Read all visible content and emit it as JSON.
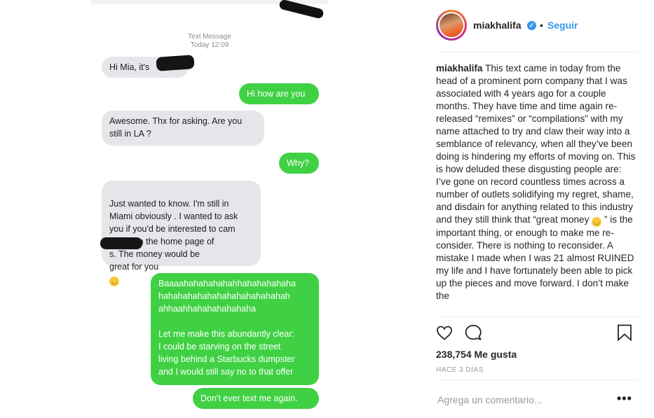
{
  "sms": {
    "meta_label": "Text Message",
    "meta_time": "Today 12:09",
    "messages": [
      {
        "direction": "incoming",
        "text": "Hi Mia, it's"
      },
      {
        "direction": "outgoing",
        "text": "Hi how are you"
      },
      {
        "direction": "incoming",
        "text": "Awesome. Thx for asking. Are you\nstill in LA ?"
      },
      {
        "direction": "outgoing",
        "text": "Why?"
      },
      {
        "direction": "incoming",
        "text": "Just wanted to know. I'm still in\nMiami obviously . I wanted to ask\nyou if you'd be interested to cam\nfor us on the home page of\n             s. The money would be\ngreat for you"
      },
      {
        "direction": "outgoing",
        "text": "Baaaahahahahahahhahahahahaha\nhahahahahahahahahahahahahah\nahhaahhahahahahahaha\n\nLet me make this abundantly clear:\nI could be starving on the street\nliving behind a Starbucks dumpster\nand I would still say no to that offer"
      },
      {
        "direction": "outgoing",
        "text": "Don't ever text me again."
      }
    ],
    "bubble_in_color": "#e5e5ea",
    "bubble_out_color": "#3fd143"
  },
  "post": {
    "username": "miakhalifa",
    "verified": true,
    "separator": "•",
    "follow_label": "Seguir",
    "follow_color": "#3897f0",
    "caption_username": "miakhalifa",
    "caption_before_emoji": "This text came in today from the head of a prominent porn company that I was associated with 4 years ago for a couple months. They have time and time again re-released “remixes” or “compilations” with my name attached to try and claw their way into a semblance of relevancy, when all they’ve been doing is hindering my efforts of moving on. This is how deluded these disgusting people are: I’ve gone on record countless times across a number of outlets solidifying my regret, shame, and disdain for anything related to this industry and they still think that “great money",
    "caption_after_emoji": "” is the important thing, or enough to make me re-consider. There is nothing to reconsider. A mistake I made when I was 21 almost RUINED my life and I have fortunately been able to pick up the pieces and move forward. I don’t make the",
    "likes": "238,754 Me gusta",
    "time_ago": "HACE 3 DÍAS",
    "comment_placeholder": "Agrega un comentario...",
    "more_label": "•••",
    "icons": {
      "like": "heart-icon",
      "comment": "comment-icon",
      "save": "bookmark-icon",
      "more": "more-options-icon"
    }
  }
}
